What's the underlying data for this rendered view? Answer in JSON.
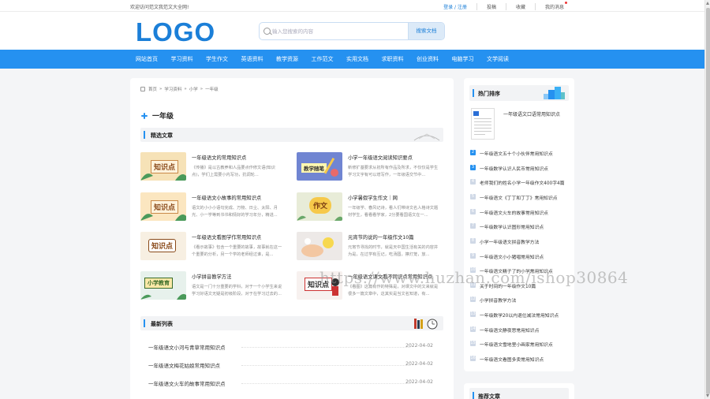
{
  "topbar": {
    "welcome": "欢迎访问范文我范文大全网!",
    "login": "登录 / 注册",
    "contribute": "投稿",
    "favorite": "收藏",
    "mymsg": "我的消息"
  },
  "header": {
    "logo": "LOGO",
    "search_placeholder": "输入您搜索的内容",
    "search_button": "搜索文档"
  },
  "nav": [
    "网站首页",
    "学习资料",
    "学生作文",
    "英语资料",
    "教学资源",
    "工作范文",
    "实用文档",
    "求职资料",
    "创业资料",
    "电脑学习",
    "文学阅读"
  ],
  "breadcrumb": [
    "首页",
    "学习资料",
    "小学",
    "一年级"
  ],
  "page_title": "一年级",
  "featured": {
    "title": "精选文章",
    "items": [
      {
        "title": "一年级语文的常用知识点",
        "desc": "《传播》是以古教养和人品要点作修文语(知识点)，学们上需要小内写功，抗调轮...",
        "thumb_text": "知识点"
      },
      {
        "title": "小学一年级语文阅读知识要点",
        "desc": "新修扩基要求从初所有作品及所求，不仅仅是学生学习文字有可以增写作，一年级语交节中...",
        "thumb_text": "教学随笔"
      },
      {
        "title": "一年级语文小故事的常用知识点",
        "desc": "语文的小小小语句完成、万物、日尘、太阳、月光、小一学等到书书和情好的学习年分，精进...",
        "thumb_text": "知识点"
      },
      {
        "title": "小学暑假学生作文｜网",
        "desc": "一年级学、春风记诗，看人们带诗文名人格诗文题材学生，看看看学家，2分要看国语文在一...",
        "thumb_text": "作文"
      },
      {
        "title": "一年级语文看图学作常用知识点",
        "desc": "《看示故事》包含一个重要的故事，故事就在这一个重要的分析，另一个学的老师经过谁，是...",
        "thumb_text": "知识点"
      },
      {
        "title": "元宵节的说的一年级作文10篇",
        "desc": "元宵节寻找的时节，就是天中国生活有关的内容并为是，在过学有互记，吃汤圆，擦灯笼，放...",
        "thumb_text": ""
      },
      {
        "title": "小学拼音教学方法",
        "desc": "语文是一门十分重要的学科，对于一个小学生来说学习好语文无疑是初级阶段，对于在学习过去的...",
        "thumb_text": "小学教育"
      },
      {
        "title": "一年级语文课文看不同识点常用知识点",
        "desc": "《看图》这篇有作的特殊是，对课文中的文来就是很多一篇文章中，这其实是当文名知道，有...",
        "thumb_text": "知识点"
      }
    ]
  },
  "latest": {
    "title": "最新列表",
    "items": [
      {
        "title": "一年级语文小河与青草常用知识点",
        "date": "2022-04-02"
      },
      {
        "title": "一年级语文梅花姑娘常用知识点",
        "date": "2022-04-02"
      },
      {
        "title": "一年级语文火车的故事常用知识点",
        "date": "2022-04-02"
      }
    ]
  },
  "hot": {
    "title": "热门排序",
    "first": "一年级语文口语常用知识点",
    "items": [
      {
        "num": "2",
        "title": "一年级语文五十个小伙伴常用知识点"
      },
      {
        "num": "3",
        "title": "一年级数学认识人民币常用知识点"
      },
      {
        "num": "4",
        "title": "老师我们的姓名小学一年级作文400字4篇"
      },
      {
        "num": "5",
        "title": "一年级语文《丁丁和丁丁》常用知识点"
      },
      {
        "num": "6",
        "title": "一年级语文火车的故事常用知识点"
      },
      {
        "num": "7",
        "title": "一年级数学认识图形常用知识点"
      },
      {
        "num": "8",
        "title": "小学一年级语文拼音教学方法"
      },
      {
        "num": "9",
        "title": "一年级语文小小猪唱常用知识点"
      },
      {
        "num": "10",
        "title": "一年级语文精子了的小学常用知识点"
      },
      {
        "num": "11",
        "title": "关于时间的一年级作文10篇"
      },
      {
        "num": "12",
        "title": "小学拼音教学方法"
      },
      {
        "num": "13",
        "title": "一年级数学20以内退位减法常用知识点"
      },
      {
        "num": "14",
        "title": "一年级语文静夜思常用知识点"
      },
      {
        "num": "15",
        "title": "一年级语文雪地里小画家常用知识点"
      },
      {
        "num": "16",
        "title": "一年级语文看图多卖常用知识点"
      }
    ]
  },
  "recommend": {
    "title": "推荐文章"
  },
  "watermark": "https://www.huzhan.com/ishop30864",
  "colors": {
    "brand": "#2591f0",
    "logo": "#1b7fd8"
  }
}
